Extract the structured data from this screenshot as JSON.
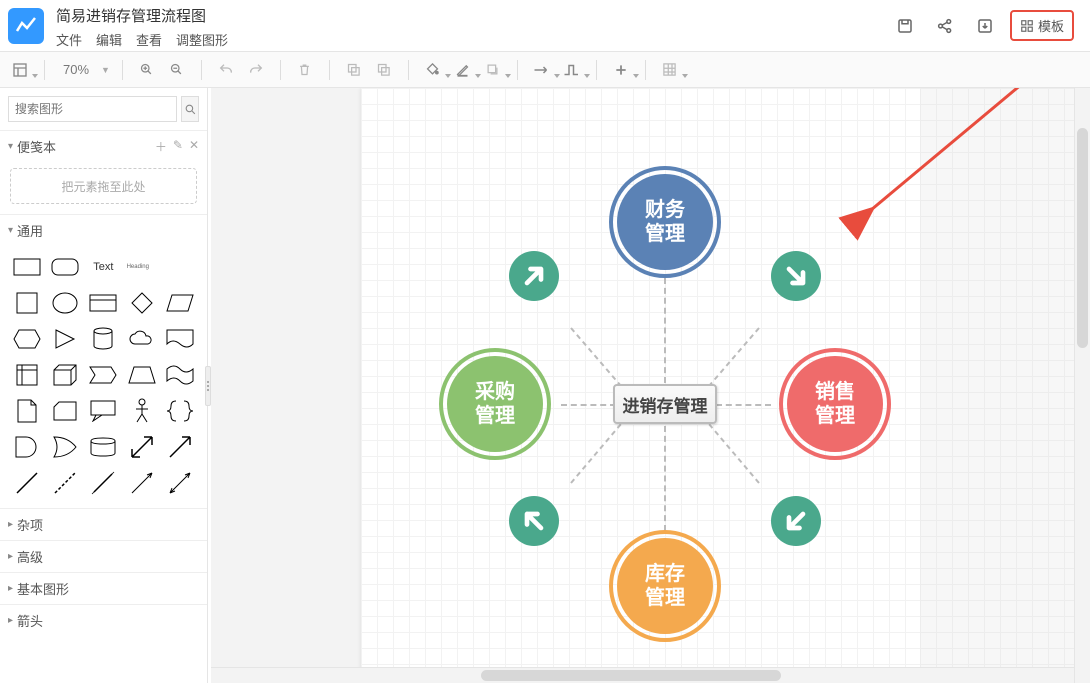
{
  "header": {
    "doc_title": "简易进销存管理流程图",
    "menu": {
      "file": "文件",
      "edit": "编辑",
      "view": "查看",
      "adjust": "调整图形"
    },
    "template_btn": "模板"
  },
  "toolbar": {
    "zoom": "70%"
  },
  "sidebar": {
    "search_placeholder": "搜索图形",
    "sections": {
      "scratchpad": "便笺本",
      "drop_hint": "把元素拖至此处",
      "general": "通用",
      "misc": "杂项",
      "advanced": "高级",
      "basic_shapes": "基本图形",
      "arrows": "箭头",
      "text_label": "Text",
      "heading_label": "Heading"
    }
  },
  "diagram": {
    "center": "进销存管理",
    "top": "财务\n管理",
    "left": "采购\n管理",
    "right": "销售\n管理",
    "bottom": "库存\n管理"
  },
  "colors": {
    "blue": "#5b82b5",
    "green": "#8cc26f",
    "red": "#ef6b6b",
    "orange": "#f4a94e",
    "teal": "#4aa88c"
  }
}
